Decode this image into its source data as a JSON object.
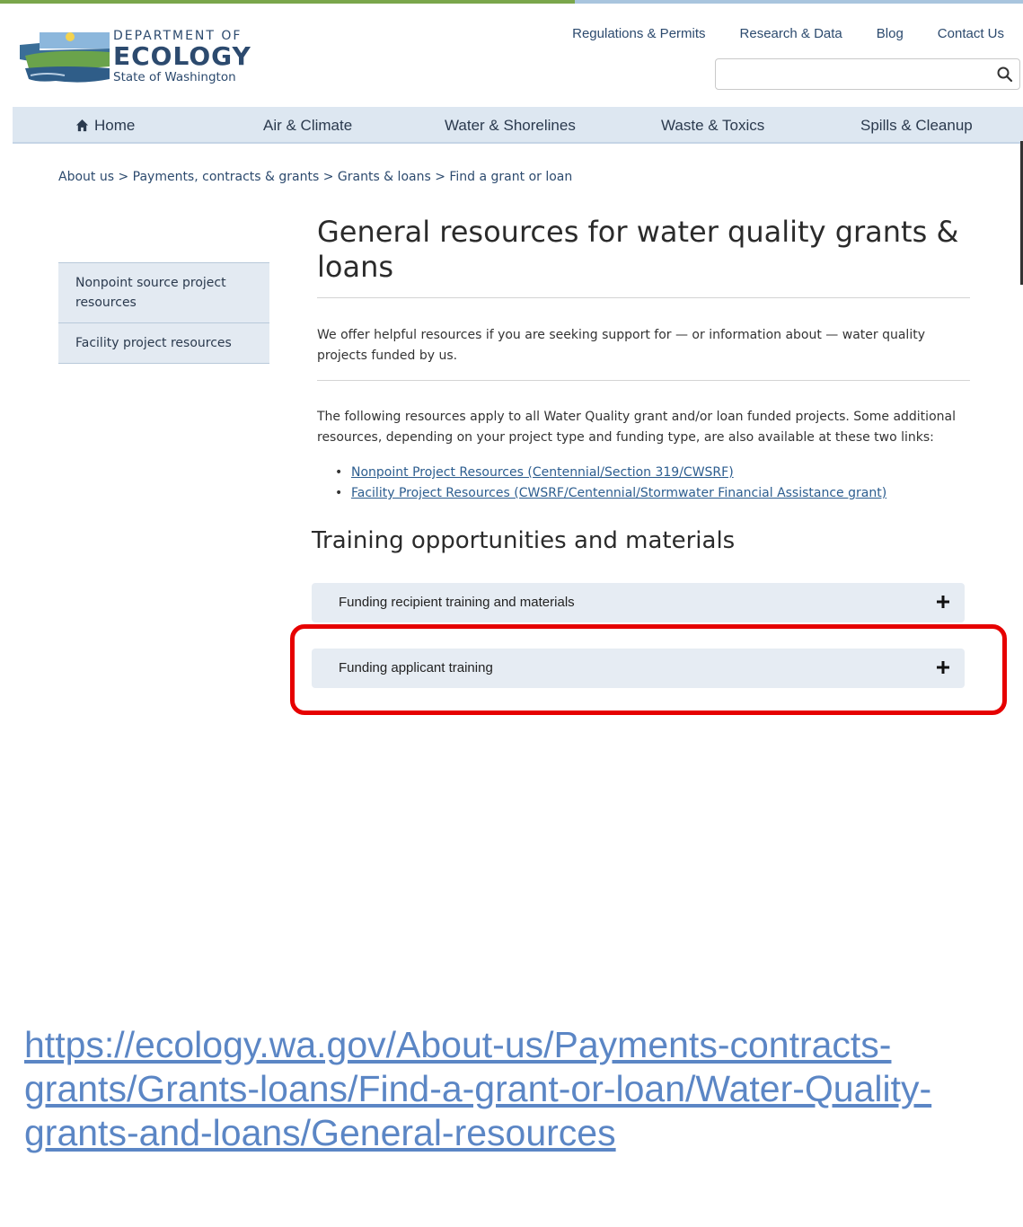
{
  "logo": {
    "line1": "DEPARTMENT OF",
    "line2": "ECOLOGY",
    "line3": "State of Washington"
  },
  "util_nav": {
    "items": [
      "Regulations & Permits",
      "Research & Data",
      "Blog",
      "Contact Us"
    ]
  },
  "search": {
    "placeholder": ""
  },
  "main_nav": {
    "items": [
      "Home",
      "Air & Climate",
      "Water & Shorelines",
      "Waste & Toxics",
      "Spills & Cleanup"
    ]
  },
  "breadcrumb": "About us > Payments, contracts & grants > Grants & loans > Find a grant or loan",
  "sidebar": {
    "items": [
      "Nonpoint source project resources",
      "Facility project resources"
    ]
  },
  "page": {
    "title": "General resources for water quality grants & loans",
    "intro": "We offer helpful resources if you are seeking support for — or information about — water quality projects funded by us.",
    "para2": "The following resources apply to all Water Quality grant and/or loan funded projects. Some additional resources, depending on your project type and funding type, are also available at these two links:",
    "links": [
      "Nonpoint Project Resources  (Centennial/Section 319/CWSRF)",
      "Facility Project Resources  (CWSRF/Centennial/Stormwater Financial Assistance grant)"
    ],
    "section_heading": "Training opportunities and materials",
    "accordions": [
      "Funding recipient training and materials",
      "Funding applicant training"
    ]
  },
  "url_caption": "https://ecology.wa.gov/About-us/Payments-contracts-grants/Grants-loans/Find-a-grant-or-loan/Water-Quality-grants-and-loans/General-resources",
  "colors": {
    "highlight": "#e60000",
    "nav_bg": "#dde7f1",
    "brand_navy": "#2c4a6e",
    "link": "#2c5d8f"
  }
}
